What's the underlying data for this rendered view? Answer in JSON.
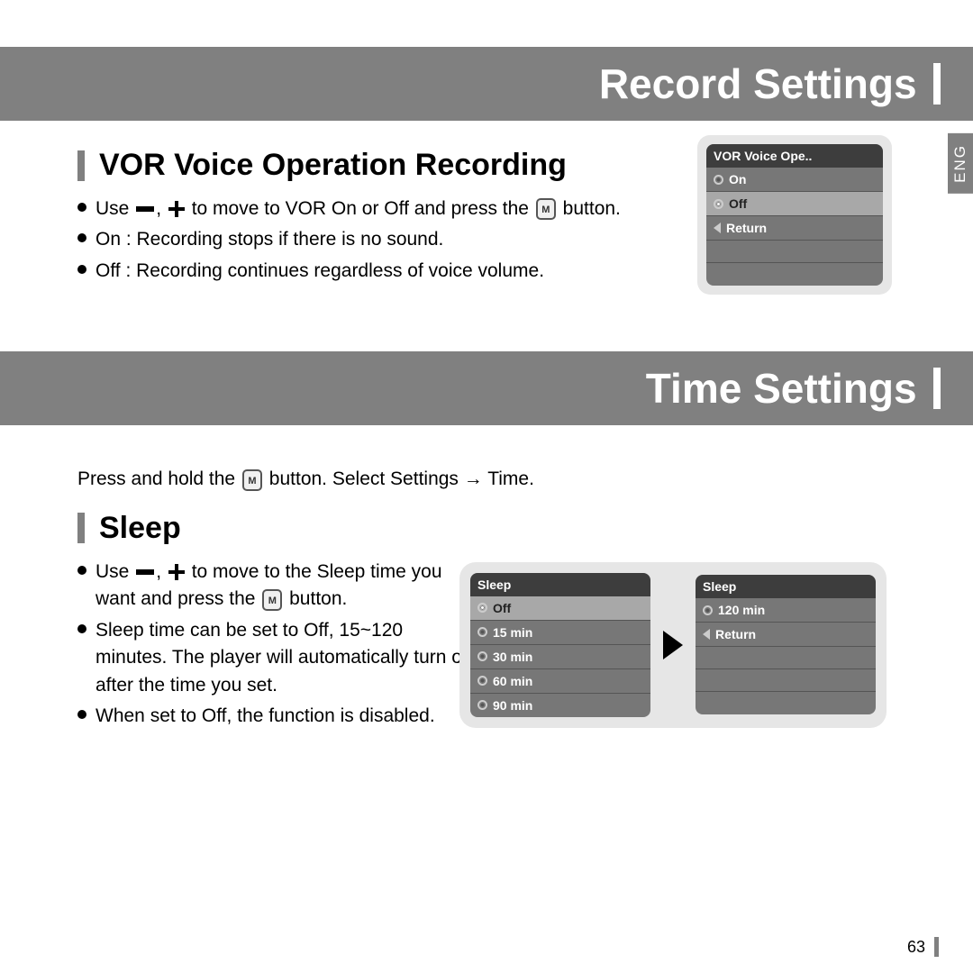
{
  "bands": {
    "record": "Record Settings",
    "time": "Time Settings"
  },
  "lang_tab": "ENG",
  "vor": {
    "heading": "VOR Voice Operation Recording",
    "bul1_a": "Use ",
    "bul1_b": " to move to VOR On or Off and press the ",
    "bul1_c": " button.",
    "bul2": "On : Recording stops if there is no sound.",
    "bul3": "Off : Recording continues regardless of voice volume.",
    "screen": {
      "title": "VOR Voice Ope..",
      "on": "On",
      "off": "Off",
      "return": "Return"
    }
  },
  "time_intro_a": "Press and hold the ",
  "time_intro_b": " button. Select Settings → Time.",
  "sleep": {
    "heading": "Sleep",
    "bul1_a": "Use ",
    "bul1_b": " to move to the Sleep time you want and press the ",
    "bul1_c": " button.",
    "bul2": "Sleep time can be set to Off, 15~120 minutes. The player will automatically turn off after the time you set.",
    "bul3": "When set to Off, the function is disabled.",
    "screen1": {
      "title": "Sleep",
      "r0": "Off",
      "r1": "15 min",
      "r2": "30 min",
      "r3": "60 min",
      "r4": "90 min"
    },
    "screen2": {
      "title": "Sleep",
      "r0": "120 min",
      "r1": "Return"
    }
  },
  "icons": {
    "m_label": "M"
  },
  "page_number": "63"
}
